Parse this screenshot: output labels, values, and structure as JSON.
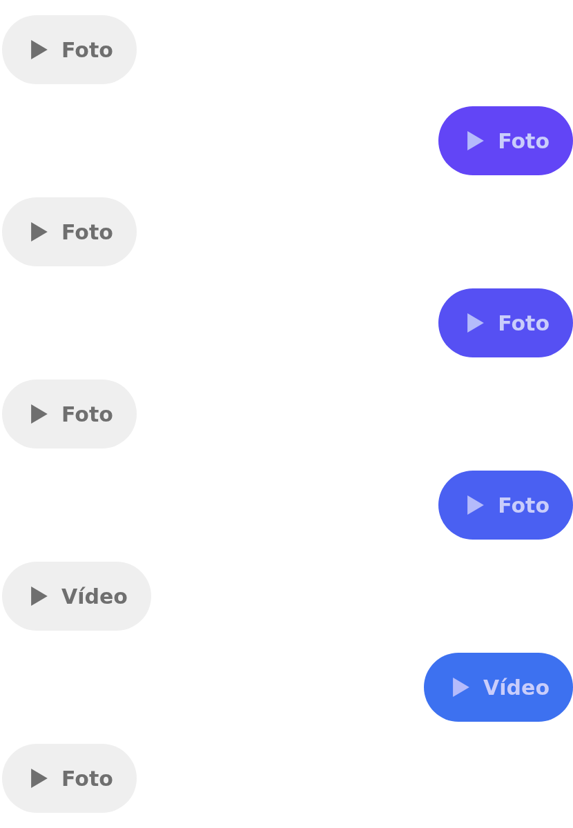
{
  "messages": [
    {
      "kind": "received",
      "label": "Foto"
    },
    {
      "kind": "sent",
      "label": "Foto",
      "color": "#6245f6"
    },
    {
      "kind": "received",
      "label": "Foto"
    },
    {
      "kind": "sent",
      "label": "Foto",
      "color": "#5650f3"
    },
    {
      "kind": "received",
      "label": "Foto"
    },
    {
      "kind": "sent",
      "label": "Foto",
      "color": "#4a60f2"
    },
    {
      "kind": "received",
      "label": "Vídeo"
    },
    {
      "kind": "sent",
      "label": "Vídeo",
      "color": "#3d71f0"
    },
    {
      "kind": "received",
      "label": "Foto"
    }
  ]
}
